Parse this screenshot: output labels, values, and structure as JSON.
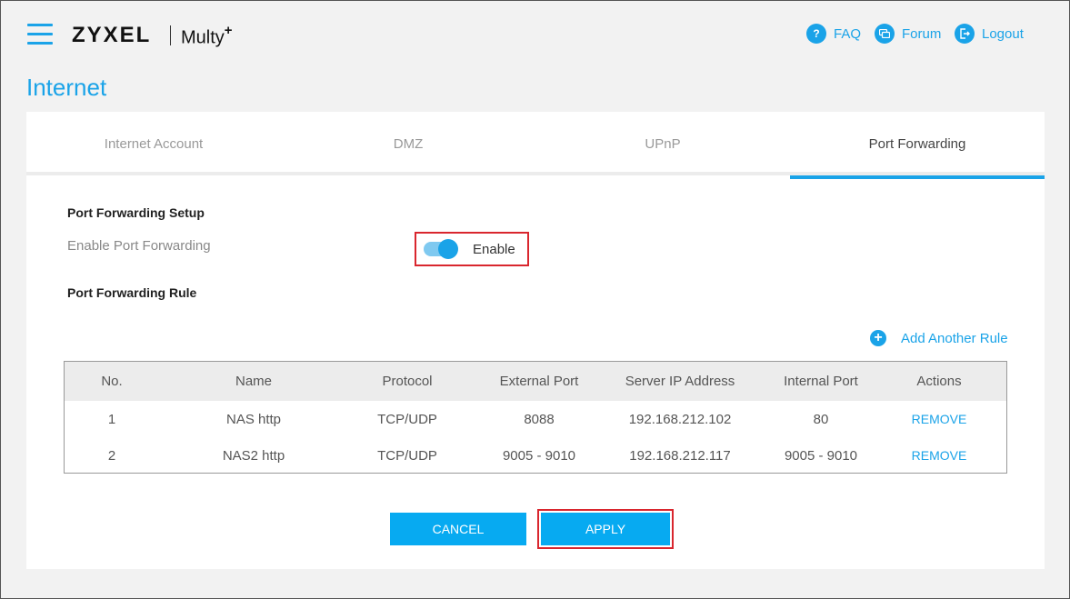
{
  "header": {
    "brand": "ZYXEL",
    "product": "Multy",
    "product_sup": "+",
    "links": [
      {
        "label": "FAQ",
        "icon": "question-icon"
      },
      {
        "label": "Forum",
        "icon": "chat-icon"
      },
      {
        "label": "Logout",
        "icon": "logout-icon"
      }
    ]
  },
  "page_title": "Internet",
  "tabs": [
    {
      "label": "Internet Account"
    },
    {
      "label": "DMZ"
    },
    {
      "label": "UPnP"
    },
    {
      "label": "Port Forwarding",
      "active": true
    }
  ],
  "setup": {
    "title": "Port Forwarding Setup",
    "enable_label": "Enable Port Forwarding",
    "toggle_text": "Enable"
  },
  "rule": {
    "title": "Port Forwarding Rule",
    "add_label": "Add Another Rule"
  },
  "table": {
    "headers": [
      "No.",
      "Name",
      "Protocol",
      "External Port",
      "Server IP Address",
      "Internal Port",
      "Actions"
    ],
    "rows": [
      [
        "1",
        "NAS http",
        "TCP/UDP",
        "8088",
        "192.168.212.102",
        "80",
        "REMOVE"
      ],
      [
        "2",
        "NAS2 http",
        "TCP/UDP",
        "9005 - 9010",
        "192.168.212.117",
        "9005 - 9010",
        "REMOVE"
      ]
    ]
  },
  "buttons": {
    "cancel": "CANCEL",
    "apply": "APPLY"
  },
  "colors": {
    "accent": "#1aa3e8",
    "highlight": "#d9262e"
  }
}
